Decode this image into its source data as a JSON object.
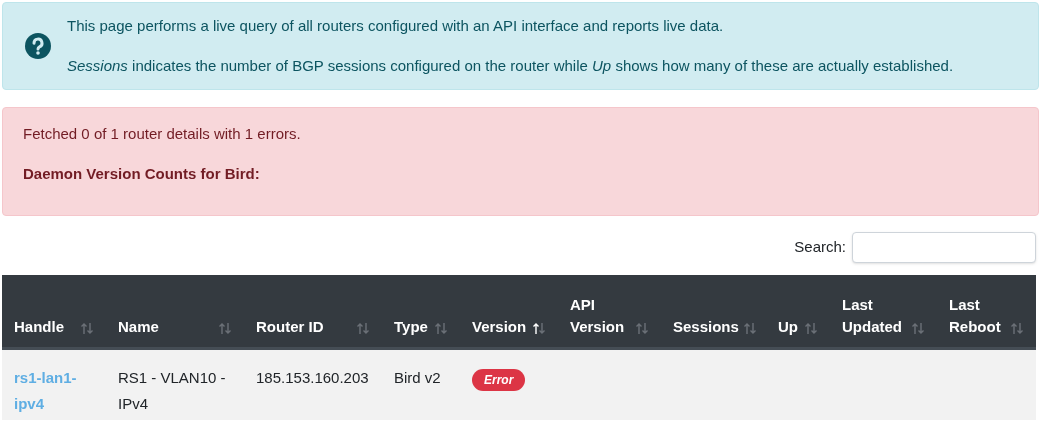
{
  "info_alert": {
    "paragraphs": [
      "This page performs a live query of all routers configured with an API interface and reports live data.",
      "*Sessions* indicates the number of BGP sessions configured on the router while *Up* shows how many of these are actually established."
    ]
  },
  "error_alert": {
    "message": "Fetched 0 of 1 router details with 1 errors.",
    "heading": "Daemon Version Counts for Bird:"
  },
  "search": {
    "label": "Search:"
  },
  "table": {
    "columns": [
      {
        "label": "Handle",
        "sorted_ascending": false
      },
      {
        "label": "Name",
        "sorted_ascending": false
      },
      {
        "label": "Router ID",
        "sorted_ascending": false
      },
      {
        "label": "Type",
        "sorted_ascending": false
      },
      {
        "label": "Version",
        "sorted_ascending": true
      },
      {
        "label": "API Version",
        "sorted_ascending": false
      },
      {
        "label": "Sessions",
        "sorted_ascending": false
      },
      {
        "label": "Up",
        "sorted_ascending": false
      },
      {
        "label": "Last Updated",
        "sorted_ascending": false
      },
      {
        "label": "Last Reboot",
        "sorted_ascending": false
      }
    ],
    "rows": [
      {
        "handle": "rs1-lan1-ipv4",
        "name": "RS1 - VLAN10 - IPv4",
        "router_id": "185.153.160.203",
        "type": "Bird v2",
        "version": {
          "kind": "badge",
          "text": "Error"
        }
      }
    ]
  }
}
